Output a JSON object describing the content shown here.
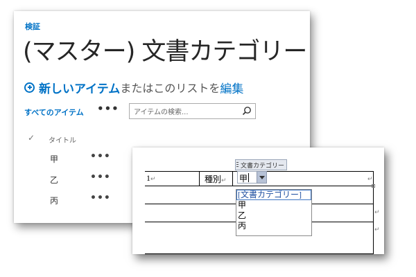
{
  "sharepoint": {
    "breadcrumb": "検証",
    "title": "(マスター) 文書カテゴリー",
    "new_item_label": "新しいアイテム",
    "or_text": "またはこのリストを",
    "edit_label": "編集",
    "view_label": "すべてのアイテム",
    "view_more": "•••",
    "search_placeholder": "アイテムの検索...",
    "columns": {
      "check": "✓",
      "title": "タイトル"
    },
    "rows": [
      {
        "title": "甲",
        "more": "•••"
      },
      {
        "title": "乙",
        "more": "•••"
      },
      {
        "title": "丙",
        "more": "•••"
      }
    ],
    "accent_color": "#0072c6"
  },
  "word": {
    "content_control_tag": "文書カテゴリー",
    "cells": {
      "number": "1",
      "type_label": "種別"
    },
    "content_control_value": "甲",
    "paragraph_mark": "↵",
    "dropdown_options": [
      "[文書カテゴリー]",
      "甲",
      "乙",
      "丙"
    ],
    "selected_option_index": 0
  }
}
